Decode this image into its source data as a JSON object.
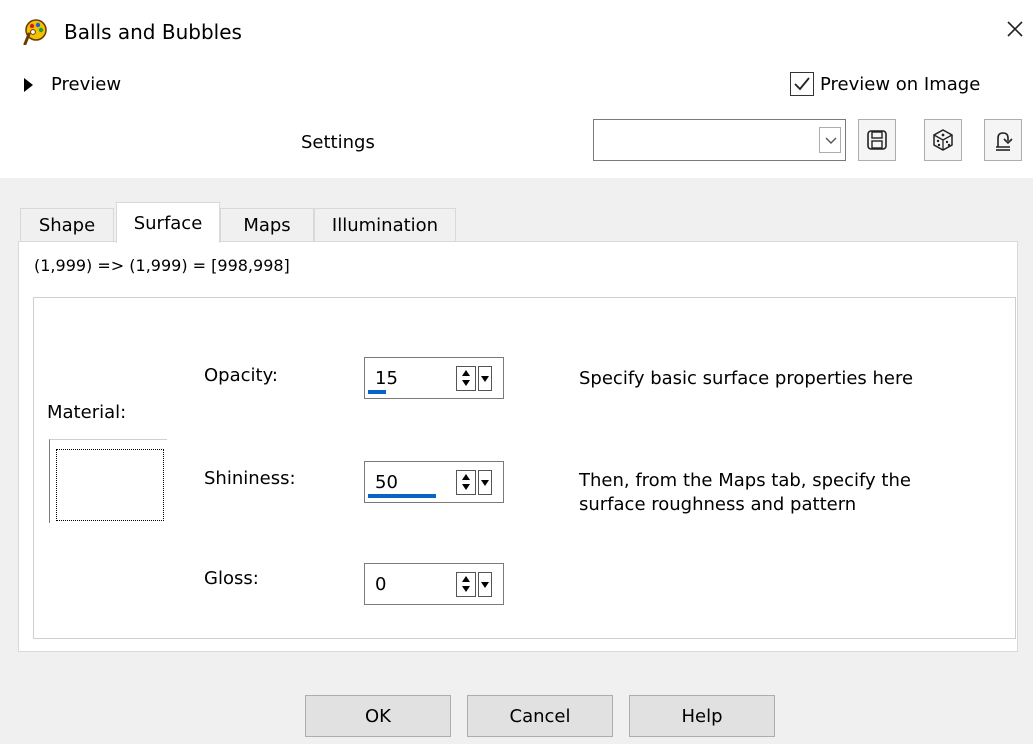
{
  "window": {
    "title": "Balls and Bubbles",
    "icon": "paint-palette-icon",
    "close_icon": "close-icon"
  },
  "preview": {
    "toggle_label": "Preview",
    "preview_on_image_label": "Preview on Image",
    "preview_on_image_checked": true
  },
  "settings": {
    "label": "Settings",
    "combo_value": "",
    "buttons": [
      "save-icon",
      "randomize-dice-icon",
      "reset-icon"
    ]
  },
  "tabs": [
    {
      "label": "Shape",
      "active": false
    },
    {
      "label": "Surface",
      "active": true
    },
    {
      "label": "Maps",
      "active": false
    },
    {
      "label": "Illumination",
      "active": false
    }
  ],
  "coords_text": "(1,999) => (1,999) = [998,998]",
  "surface": {
    "material_label": "Material:",
    "opacity": {
      "label": "Opacity:",
      "value": "15",
      "fill_fraction": 0.15
    },
    "shininess": {
      "label": "Shininess:",
      "value": "50",
      "fill_fraction": 0.5
    },
    "gloss": {
      "label": "Gloss:",
      "value": "0",
      "fill_fraction": 0
    },
    "help_line1": "Specify basic surface properties here",
    "help_line2a": "Then, from the Maps tab, specify the",
    "help_line2b": "surface roughness and pattern"
  },
  "buttons": {
    "ok": "OK",
    "cancel": "Cancel",
    "help": "Help"
  },
  "colors": {
    "accent": "#0a64c8",
    "dialog_bg": "#f0f0f0"
  }
}
